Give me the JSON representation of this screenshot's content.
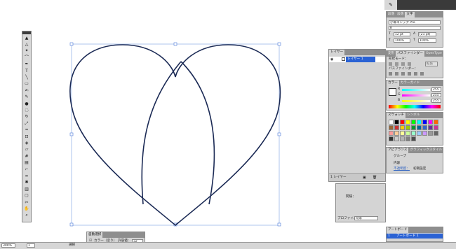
{
  "document": {
    "zoom": "300%",
    "page": "1",
    "mode": "選択"
  },
  "toolbar": {
    "tools": [
      "selection-tool",
      "direct-selection-tool",
      "magic-wand-tool",
      "lasso-tool",
      "pen-tool",
      "type-tool",
      "line-tool",
      "rectangle-tool",
      "paintbrush-tool",
      "pencil-tool",
      "blob-brush-tool",
      "eraser-tool",
      "rotate-tool",
      "scale-tool",
      "warp-tool",
      "free-transform-tool",
      "shape-builder-tool",
      "perspective-tool",
      "mesh-tool",
      "gradient-tool",
      "eyedropper-tool",
      "blend-tool",
      "symbol-sprayer-tool",
      "graph-tool",
      "artboard-tool",
      "slice-tool",
      "hand-tool",
      "zoom-tool"
    ]
  },
  "character_panel": {
    "tabs": [
      "段落",
      "段落",
      "文字"
    ],
    "font_name": "小塚ゴシック Pro",
    "font_style": "R",
    "font_size": "12 pt",
    "leading": "(21 pt)",
    "h_scale": "100%",
    "v_scale": "100%"
  },
  "layers_panel": {
    "tab": "レイヤー",
    "layer_name": "レイヤー 1",
    "footer_label": "1 レイヤー"
  },
  "pathfinder_panel": {
    "tabs": [
      "変形",
      "パスファインダー",
      "OpenType"
    ],
    "shape_modes_label": "形状モード：",
    "pathfinder_label": "パスファインダー：",
    "expand_label": "拡張"
  },
  "color_panel": {
    "tabs": [
      "カラー",
      "カラーガイド"
    ],
    "r_label": "R",
    "g_label": "G",
    "b_label": "B",
    "r": "255",
    "g": "255",
    "b": "255"
  },
  "swatches_panel": {
    "tabs": [
      "スウォッチ",
      "シンボル"
    ],
    "colors": [
      "#ffffff",
      "#000000",
      "#ff0000",
      "#ffff00",
      "#00ff00",
      "#00ffff",
      "#0000ff",
      "#ff00ff",
      "#ff6600",
      "#996633",
      "#cc3333",
      "#ffcc00",
      "#99cc00",
      "#009933",
      "#006699",
      "#3366cc",
      "#663399",
      "#cc3399",
      "#ff9999",
      "#ffcc99",
      "#ffff99",
      "#ccff99",
      "#99ffcc",
      "#99ccff",
      "#cc99ff",
      "#999999",
      "#666666",
      "#333333",
      "#cccccc",
      "#b3b3b3",
      "#808080",
      "#4d4d4d"
    ]
  },
  "appearance_panel": {
    "tabs": [
      "アピアランス",
      "グラフィックスタイル"
    ],
    "group_label": "グループ",
    "contents_label": "内容",
    "opacity_label": "不透明度：",
    "opacity_value": "初期設定"
  },
  "align_panel": {
    "distribute_label": "間隔：",
    "profile_label": "プロファイル：",
    "profile_value": "均等"
  },
  "artboard_panel": {
    "tab": "アートボード",
    "item_index": "1",
    "item_name": "アートボード 1"
  },
  "auto_select_panel": {
    "title": "自動選択",
    "checkbox_label": "カラー（塗り）",
    "tolerance_label": "許容値：",
    "tolerance_value": "32"
  }
}
